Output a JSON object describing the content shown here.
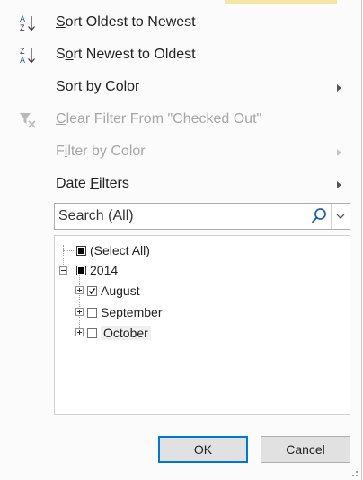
{
  "menu": {
    "sort_oldest": {
      "label": "Sort Oldest to Newest",
      "mnemonic": "S",
      "icon": "sort-ascending-icon",
      "enabled": true
    },
    "sort_newest": {
      "label": "Sort Newest to Oldest",
      "mnemonic": "o",
      "icon": "sort-descending-icon",
      "enabled": true
    },
    "sort_by_color": {
      "label": "Sort by Color",
      "mnemonic": "t",
      "enabled": true,
      "submenu": true
    },
    "clear_filter": {
      "label": "Clear Filter From \"Checked Out\"",
      "mnemonic": "C",
      "icon": "clear-filter-icon",
      "enabled": false
    },
    "filter_by_color": {
      "label": "Filter by Color",
      "mnemonic": "i",
      "enabled": false,
      "submenu": true
    },
    "date_filters": {
      "label": "Date Filters",
      "mnemonic": "F",
      "enabled": true,
      "submenu": true
    }
  },
  "search": {
    "placeholder": "Search (All)",
    "icon": "search-icon"
  },
  "tree": {
    "select_all": {
      "label": "(Select All)",
      "state": "partial"
    },
    "year": {
      "label": "2014",
      "state": "partial",
      "expanded": true
    },
    "months": [
      {
        "label": "August",
        "state": "checked"
      },
      {
        "label": "September",
        "state": "unchecked"
      },
      {
        "label": "October",
        "state": "unchecked",
        "highlighted": true
      }
    ]
  },
  "buttons": {
    "ok": "OK",
    "cancel": "Cancel"
  },
  "colors": {
    "accent": "#0078d7",
    "disabled_text": "#a6a6a6",
    "panel_bg": "#fbfbfb"
  }
}
